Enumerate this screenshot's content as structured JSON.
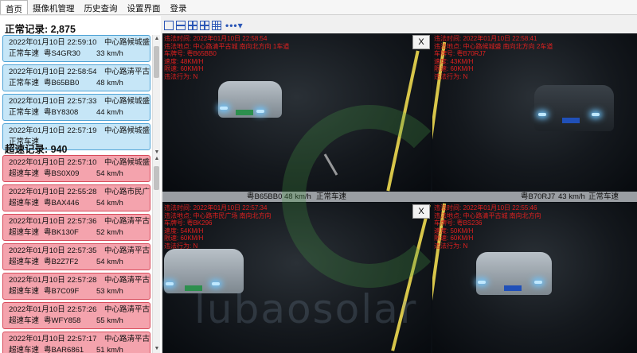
{
  "menu": [
    "首页",
    "摄像机管理",
    "历史查询",
    "设置界面",
    "登录"
  ],
  "normal": {
    "title": "正常记录: 2,875",
    "records": [
      {
        "time": "2022年01月10日 22:59:10",
        "location": "中心路候城盛 南",
        "type": "正常车速",
        "plate": "粤S4GR30",
        "speed": "33 km/h"
      },
      {
        "time": "2022年01月10日 22:58:54",
        "location": "中心路清平古城",
        "type": "正常车速",
        "plate": "粤B65BB0",
        "speed": "48 km/h"
      },
      {
        "time": "2022年01月10日 22:57:33",
        "location": "中心路候城盛 南",
        "type": "正常车速",
        "plate": "粤BY8308",
        "speed": "44 km/h"
      },
      {
        "time": "2022年01月10日 22:57:19",
        "location": "中心路候城盛 南",
        "type": "正常车速",
        "plate": "",
        "speed": ""
      }
    ]
  },
  "overspeed": {
    "title": "超速记录: 940",
    "records": [
      {
        "time": "2022年01月10日 22:57:10",
        "location": "中心路候城盛 南",
        "type": "超速车速",
        "plate": "粤BS0X09",
        "speed": "54 km/h"
      },
      {
        "time": "2022年01月10日 22:55:28",
        "location": "中心路市民广场",
        "type": "超速车速",
        "plate": "粤BAX446",
        "speed": "54 km/h"
      },
      {
        "time": "2022年01月10日 22:57:36",
        "location": "中心路清平古城",
        "type": "超速车速",
        "plate": "粤BK130F",
        "speed": "52 km/h"
      },
      {
        "time": "2022年01月10日 22:57:35",
        "location": "中心路清平古城",
        "type": "超速车速",
        "plate": "粤B2Z7F2",
        "speed": "54 km/h"
      },
      {
        "time": "2022年01月10日 22:57:28",
        "location": "中心路清平古城",
        "type": "超速车速",
        "plate": "粤B7C09F",
        "speed": "53 km/h"
      },
      {
        "time": "2022年01月10日 22:57:26",
        "location": "中心路清平古城",
        "type": "超速车速",
        "plate": "粤WFY858",
        "speed": "55 km/h"
      },
      {
        "time": "2022年01月10日 22:57:17",
        "location": "中心路清平古城",
        "type": "超速车速",
        "plate": "粤BAR6861",
        "speed": "51 km/h"
      }
    ]
  },
  "cameras": [
    {
      "overlay": [
        "违法时间: 2022年01月10日 22:58:54",
        "违法地点: 中心路清平古城 南向北方向 1车道",
        "车牌号: 粤B65BB0",
        "速度: 48KM/H",
        "限速: 60KM/H",
        "违法行为: N"
      ]
    },
    {
      "overlay": [
        "违法时间: 2022年01月10日 22:58:41",
        "违法地点: 中心路候城盛 南向北方向 2车道",
        "车牌号: 粤B70RJ7",
        "速度: 43KM/H",
        "限速: 60KM/H",
        "违法行为: N"
      ]
    },
    {
      "overlay": [
        "违法时间: 2022年01月10日 22:57:34",
        "违法地点: 中心路市民广场 南向北方向",
        "车牌号: 粤BK296",
        "速度: 54KM/H",
        "限速: 60KM/H",
        "违法行为: N"
      ]
    },
    {
      "overlay": [
        "违法时间: 2022年01月10日 22:55:46",
        "违法地点: 中心路清平古城 南向北方向",
        "车牌号: 粤BS236",
        "速度: 50KM/H",
        "限速: 60KM/H",
        "违法行为: N"
      ]
    }
  ],
  "close_label": "X",
  "captions": {
    "left_plate": "粤B65BB0",
    "left_speed": "48 km/h",
    "left_status": "正常车速",
    "right_plate": "粤B70RJ7",
    "right_speed": "43 km/h",
    "right_status": "正常车速"
  },
  "watermark": "lubaosolar",
  "toolbar": {
    "more": "•••▾"
  },
  "colors": {
    "normal_bg": "#c6e6f7",
    "overspeed_bg": "#f4a3ad",
    "overlay_text": "#e0201f"
  }
}
